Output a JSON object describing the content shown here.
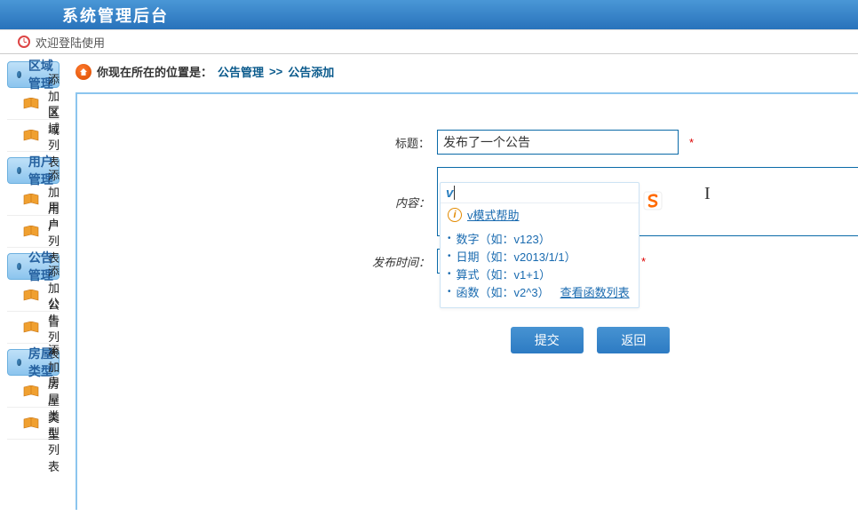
{
  "header": {
    "title": "系统管理后台"
  },
  "welcome": {
    "text": "欢迎登陆使用"
  },
  "sidebar": {
    "groups": [
      {
        "title": "区域管理",
        "items": [
          {
            "label": "添加区域"
          },
          {
            "label": "区域列表"
          }
        ]
      },
      {
        "title": "用户管理",
        "items": [
          {
            "label": "添加用户"
          },
          {
            "label": "用户列表"
          }
        ]
      },
      {
        "title": "公告管理",
        "items": [
          {
            "label": "添加公告"
          },
          {
            "label": "公告列表"
          }
        ]
      },
      {
        "title": "房屋类型",
        "items": [
          {
            "label": "添加房屋类型"
          },
          {
            "label": "房屋类型列表"
          }
        ]
      }
    ]
  },
  "breadcrumb": {
    "prefix": "你现在所在的位置是：",
    "part1": "公告管理",
    "sep": ">>",
    "part2": "公告添加"
  },
  "form": {
    "title_label": "标题：",
    "title_value": "发布了一个公告",
    "content_label": "内容：",
    "time_label": "发布时间：",
    "required_mark": "*",
    "submit": "提交",
    "back": "返回"
  },
  "ime": {
    "char": "v",
    "help_label": "v模式帮助",
    "items": [
      {
        "text": "数字（如：v123）"
      },
      {
        "text": "日期（如：v2013/1/1）"
      },
      {
        "text": "算式（如：v1+1）"
      },
      {
        "text": "函数（如：v2^3）",
        "link": "查看函数列表"
      }
    ]
  }
}
